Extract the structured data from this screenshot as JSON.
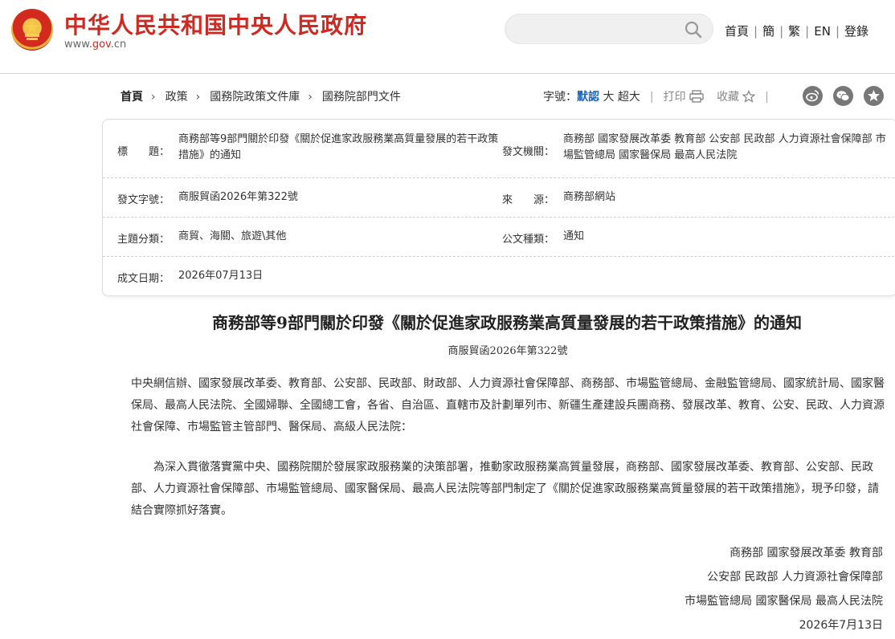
{
  "header": {
    "site_title": "中华人民共和国中央人民政府",
    "site_url_prefix": "www.",
    "site_url_highlight": "gov",
    "site_url_suffix": ".cn",
    "search_placeholder": "",
    "nav": [
      "首頁",
      "簡",
      "繁",
      "EN",
      "登錄"
    ]
  },
  "breadcrumb": {
    "items": [
      "首頁",
      "政策",
      "國務院政策文件庫",
      "國務院部門文件"
    ]
  },
  "tools": {
    "font_label": "字號：",
    "font_default": "默認",
    "font_large": "大",
    "font_xlarge": "超大",
    "print": "打印",
    "favorite": "收藏"
  },
  "info": {
    "title_label": "標　　題：",
    "title_value": "商務部等9部門關於印發《關於促進家政服務業高質量發展的若干政策措施》的通知",
    "issuer_label": "發文機關：",
    "issuer_value": "商務部 國家發展改革委 教育部 公安部 民政部 人力資源社會保障部 市場監管總局 國家醫保局 最高人民法院",
    "doc_no_label": "發文字號：",
    "doc_no_value": "商服貿函2026年第322號",
    "source_label": "來　　源：",
    "source_value": "商務部網站",
    "topic_label": "主題分類：",
    "topic_value": "商貿、海關、旅遊\\其他",
    "type_label": "公文種類：",
    "type_value": "通知",
    "date_label": "成文日期：",
    "date_value": "2026年07月13日"
  },
  "article": {
    "title": "商務部等9部門關於印發《關於促進家政服務業高質量發展的若干政策措施》的通知",
    "doc_no": "商服貿函2026年第322號",
    "recipients": "中央網信辦、國家發展改革委、教育部、公安部、民政部、財政部、人力資源社會保障部、商務部、市場監管總局、金融監管總局、國家統計局、國家醫保局、最高人民法院、全國婦聯、全國總工會，各省、自治區、直轄市及計劃單列市、新疆生產建設兵團商務、發展改革、教育、公安、民政、人力資源社會保障、市場監管主管部門、醫保局、高級人民法院：",
    "body": "　　為深入貫徹落實黨中央、國務院關於發展家政服務業的決策部署，推動家政服務業高質量發展，商務部、國家發展改革委、教育部、公安部、民政部、人力資源社會保障部、市場監管總局、國家醫保局、最高人民法院等部門制定了《關於促進家政服務業高質量發展的若干政策措施》，現予印發，請結合實際抓好落實。",
    "sign_lines": [
      "商務部 國家發展改革委 教育部",
      "公安部 民政部 人力資源社會保障部",
      "市場監管總局 國家醫保局 最高人民法院"
    ],
    "sign_date": "2026年7月13日"
  },
  "colors": {
    "brand_red": "#cc2a22",
    "link_blue": "#1565c0"
  }
}
